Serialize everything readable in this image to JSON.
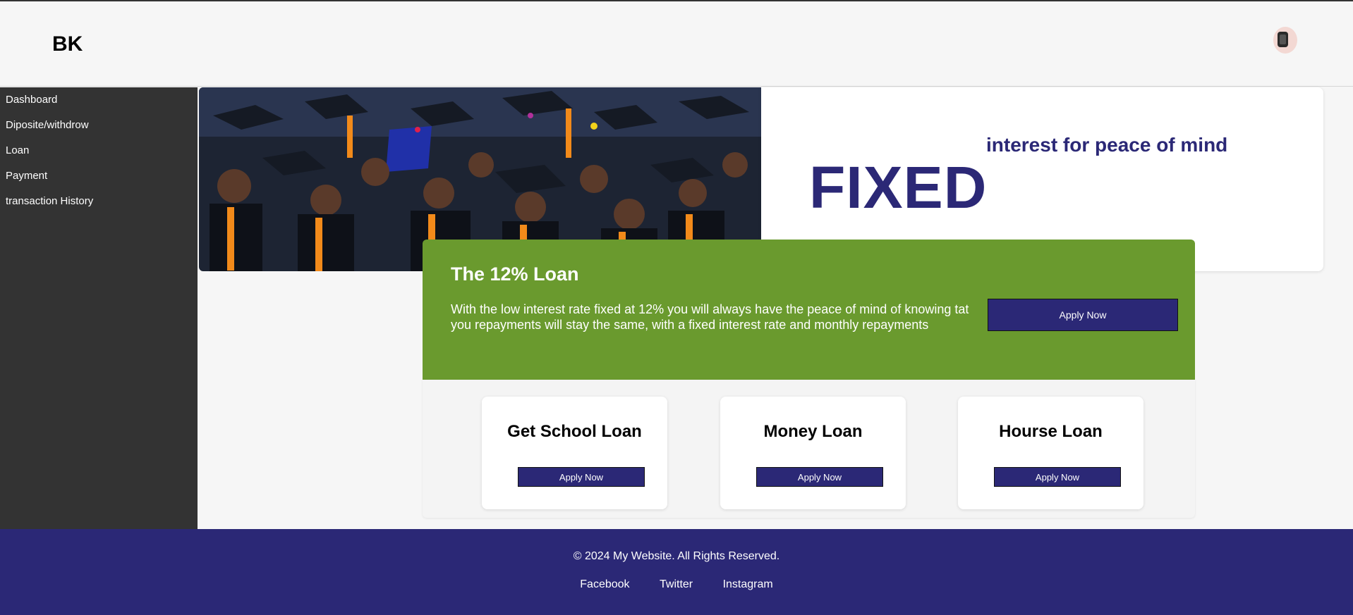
{
  "header": {
    "brand": "BK"
  },
  "sidebar": {
    "items": [
      {
        "label": "Dashboard"
      },
      {
        "label": "Diposite/withdrow"
      },
      {
        "label": "Loan"
      },
      {
        "label": "Payment"
      },
      {
        "label": "transaction History"
      }
    ]
  },
  "hero": {
    "subtitle": "interest for peace of mind",
    "headline": "FIXED"
  },
  "promo": {
    "title": "The 12% Loan",
    "text": "With the low interest rate fixed at 12% you will always have the peace of mind of knowing tat you repayments will stay the same, with a fixed interest rate and monthly repayments",
    "button": "Apply Now"
  },
  "loans": [
    {
      "title": "Get School Loan",
      "button": "Apply Now"
    },
    {
      "title": "Money Loan",
      "button": "Apply Now"
    },
    {
      "title": "Hourse Loan",
      "button": "Apply Now"
    }
  ],
  "footer": {
    "copyright": "© 2024 My Website. All Rights Reserved.",
    "links": [
      {
        "label": "Facebook"
      },
      {
        "label": "Twitter"
      },
      {
        "label": "Instagram"
      }
    ]
  },
  "colors": {
    "sidebar": "#333333",
    "accent": "#2b2876",
    "promo": "#6a9a2e",
    "background": "#f6f6f6"
  }
}
